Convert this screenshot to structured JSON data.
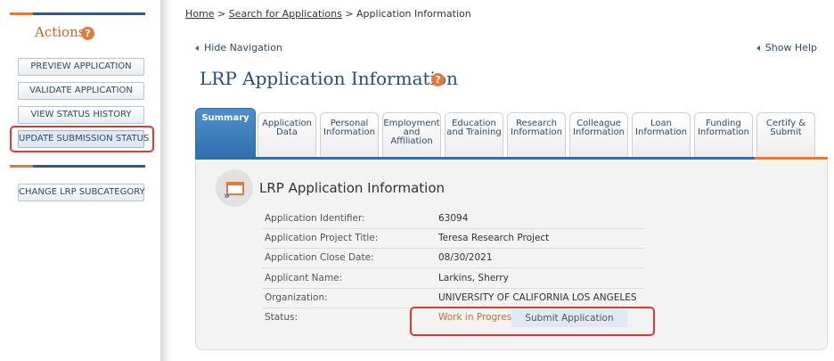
{
  "sidebar": {
    "title": "Actions",
    "help": "?",
    "buttons": [
      "PREVIEW APPLICATION",
      "VALIDATE APPLICATION",
      "VIEW STATUS HISTORY",
      "UPDATE SUBMISSION STATUS"
    ],
    "secondary_buttons": [
      "CHANGE LRP SUBCATEGORY"
    ]
  },
  "breadcrumb": {
    "home": "Home",
    "search": "Search for Applications",
    "current": "Application Information",
    "separator": ">"
  },
  "nav": {
    "hide_navigation": "Hide Navigation",
    "show_help": "Show Help"
  },
  "page": {
    "title": "LRP Application Information",
    "help": "?"
  },
  "tabs": [
    {
      "line1": "Summary",
      "line2": "",
      "line3": ""
    },
    {
      "line1": "Application",
      "line2": "Data",
      "line3": ""
    },
    {
      "line1": "Personal",
      "line2": "Information",
      "line3": ""
    },
    {
      "line1": "Employment",
      "line2": "and",
      "line3": "Affiliation"
    },
    {
      "line1": "Education",
      "line2": "and Training",
      "line3": ""
    },
    {
      "line1": "Research",
      "line2": "Information",
      "line3": ""
    },
    {
      "line1": "Colleague",
      "line2": "Information",
      "line3": ""
    },
    {
      "line1": "Loan",
      "line2": "Information",
      "line3": ""
    },
    {
      "line1": "Funding",
      "line2": "Information",
      "line3": ""
    },
    {
      "line1": "Certify &",
      "line2": "Submit",
      "line3": ""
    }
  ],
  "section": {
    "title": "LRP Application Information",
    "fields": [
      {
        "label": "Application Identifier:",
        "value": "63094"
      },
      {
        "label": "Application Project Title:",
        "value": "Teresa Research Project"
      },
      {
        "label": "Application Close Date:",
        "value": "08/30/2021"
      },
      {
        "label": "Applicant Name:",
        "value": "Larkins, Sherry"
      },
      {
        "label": "Organization:",
        "value": "UNIVERSITY OF CALIFORNIA LOS ANGELES"
      }
    ],
    "status_label": "Status:",
    "status_value": "Work in Progress",
    "submit_label": "Submit Application"
  },
  "colors": {
    "accent_orange": "#e07b39",
    "brand_blue": "#2d6fae",
    "highlight_red": "#d9393b"
  },
  "icons": [
    "help-icon",
    "triangle-left-icon",
    "application-document-icon"
  ]
}
